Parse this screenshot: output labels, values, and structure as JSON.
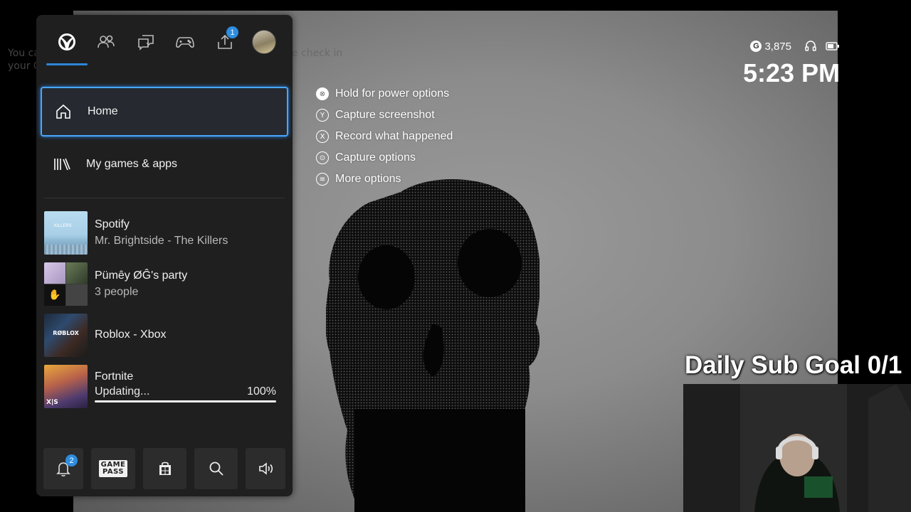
{
  "background": {
    "behind_text_left_1": "You ca",
    "behind_text_left_2": "your G",
    "behind_text_mid": "e check in"
  },
  "guide": {
    "tabs": [
      {
        "name": "xbox-logo-tab",
        "icon": "xbox-icon"
      },
      {
        "name": "people-tab",
        "icon": "people-icon"
      },
      {
        "name": "parties-chats-tab",
        "icon": "chat-icon"
      },
      {
        "name": "multiplayer-tab",
        "icon": "controller-icon"
      },
      {
        "name": "capture-share-tab",
        "icon": "share-icon",
        "badge": "1"
      },
      {
        "name": "profile-tab",
        "icon": "avatar"
      }
    ],
    "menu": {
      "home_label": "Home",
      "games_label": "My games & apps"
    },
    "recent": [
      {
        "title": "Spotify",
        "subtitle": "Mr. Brightside - The Killers"
      },
      {
        "title": "Pümêy ØĜ's party",
        "subtitle": "3 people"
      },
      {
        "title": "Roblox - Xbox",
        "thumb_text": "RØBLOX"
      },
      {
        "title": "Fortnite",
        "status": "Updating...",
        "percent": "100%",
        "progress": 1.0,
        "thumb_text": "X|S"
      }
    ],
    "bottom": {
      "notifications_badge": "2",
      "gamepass_line1": "GAME",
      "gamepass_line2": "PASS"
    }
  },
  "options": [
    {
      "glyph": "⊗",
      "label": "Hold for power options"
    },
    {
      "glyph": "Y",
      "label": "Capture screenshot"
    },
    {
      "glyph": "X",
      "label": "Record what happened"
    },
    {
      "glyph": "⊙",
      "label": "Capture options"
    },
    {
      "glyph": "≡",
      "label": "More options"
    }
  ],
  "status": {
    "gamerscore": "3,875",
    "gscore_glyph": "G",
    "time": "5:23 PM"
  },
  "overlay": {
    "sub_goal": "Daily Sub Goal 0/1"
  },
  "colors": {
    "accent": "#2d8de0",
    "panel": "#1f1f1f"
  }
}
